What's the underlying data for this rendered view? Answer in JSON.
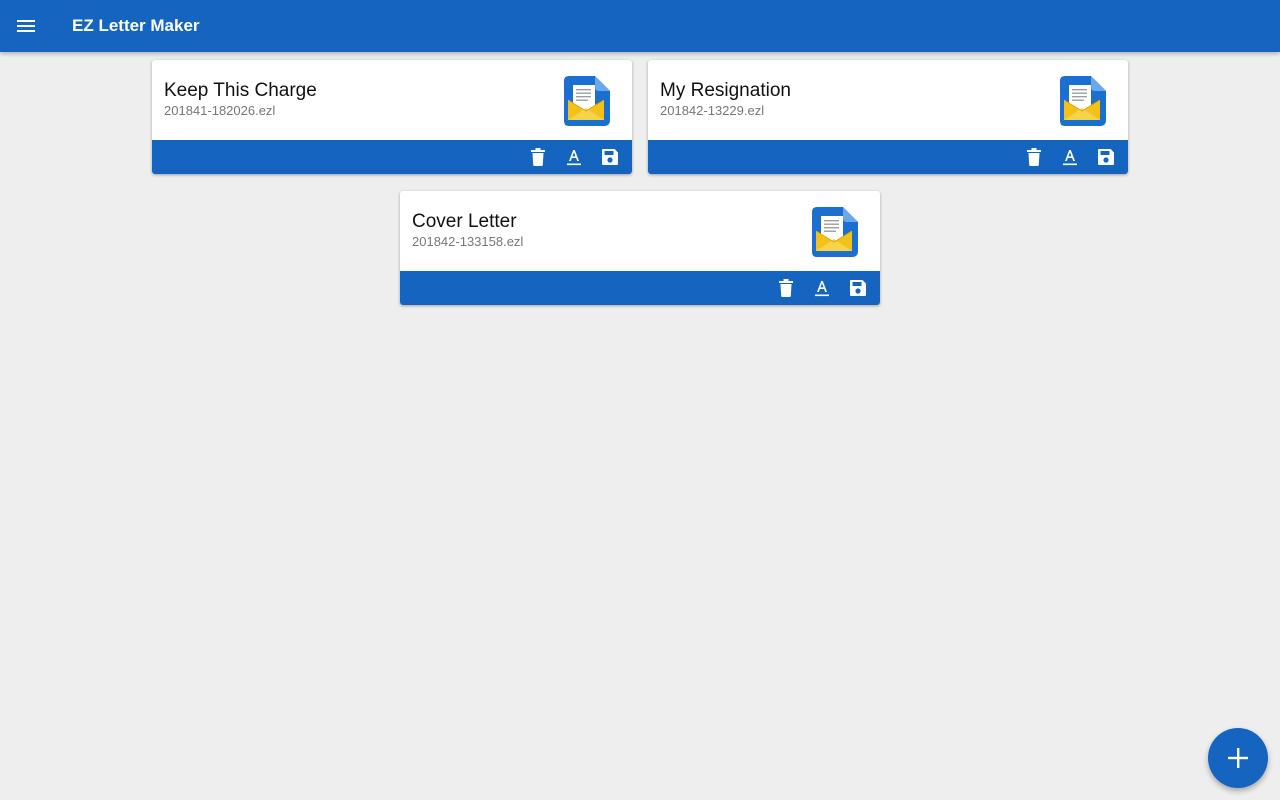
{
  "app": {
    "title": "EZ Letter Maker",
    "accent_color": "#1565c0",
    "background_color": "#eeeeee",
    "menu_icon": "hamburger-menu-icon"
  },
  "letters": [
    {
      "title": "Keep This Charge",
      "filename": "201841-182026.ezl",
      "icon": "letter-envelope-icon",
      "actions": [
        "delete-icon",
        "rename-icon",
        "save-icon"
      ]
    },
    {
      "title": "My Resignation",
      "filename": "201842-13229.ezl",
      "icon": "letter-envelope-icon",
      "actions": [
        "delete-icon",
        "rename-icon",
        "save-icon"
      ]
    },
    {
      "title": "Cover Letter",
      "filename": "201842-133158.ezl",
      "icon": "letter-envelope-icon",
      "actions": [
        "delete-icon",
        "rename-icon",
        "save-icon"
      ]
    }
  ],
  "fab": {
    "icon": "plus-icon"
  }
}
